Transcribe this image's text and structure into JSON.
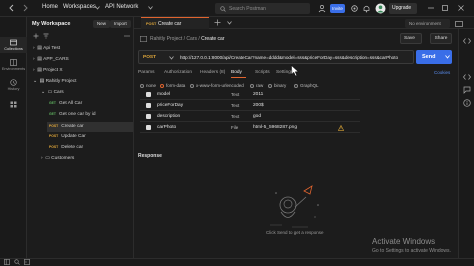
{
  "topbar": {
    "home": "Home",
    "workspaces": "Workspaces",
    "api_network": "API Network",
    "search_placeholder": "Search Postman",
    "invite": "Invite",
    "upgrade": "Upgrade"
  },
  "rail": {
    "collections": "Collections",
    "environments": "Environments",
    "history": "History"
  },
  "sidebar": {
    "workspace_title": "My Workspace",
    "new_label": "New",
    "import_label": "Import",
    "items": [
      {
        "label": "Api Test"
      },
      {
        "label": "APP_CARS"
      },
      {
        "label": "Project X"
      },
      {
        "label": "Rahitly Project"
      },
      {
        "label": "Cars"
      },
      {
        "method": "GET",
        "label": "Get All Car"
      },
      {
        "method": "GET",
        "label": "Get one car by id"
      },
      {
        "method": "POST",
        "label": "Create car"
      },
      {
        "method": "POST",
        "label": "Update Car"
      },
      {
        "method": "POST",
        "label": "Delete car"
      },
      {
        "label": "Customers"
      }
    ]
  },
  "tab": {
    "method": "POST",
    "title": "Create car"
  },
  "environment": "No environment",
  "request": {
    "breadcrumb_parent": "Rahitly Project / Cars /",
    "breadcrumb_current": "Create car",
    "save_label": "Save",
    "share_label": "Share",
    "method": "POST",
    "url": "http://127.0.0.1:8000/api/CreateCar?name=dddd&model=sss&priceForDay=sss&description=sss&carPhoto",
    "send_label": "Send",
    "tabs": [
      "Params",
      "Authorization",
      "Headers (8)",
      "Body",
      "Scripts",
      "Settings"
    ],
    "cookies_label": "Cookies",
    "body_modes": [
      "none",
      "form-data",
      "x-www-form-urlencoded",
      "raw",
      "binary",
      "GraphQL"
    ],
    "rows": [
      {
        "key": "model",
        "type": "Text",
        "value": "2011"
      },
      {
        "key": "priceForDay",
        "type": "Text",
        "value": "200$"
      },
      {
        "key": "description",
        "type": "Text",
        "value": "god"
      },
      {
        "key": "carPhoto",
        "type": "File",
        "value": "html-5_5968287.png"
      }
    ]
  },
  "response": {
    "label": "Response",
    "hint": "Click Send to get a response"
  },
  "watermark": {
    "line1": "Activate Windows",
    "line2": "Go to Settings to activate Windows."
  },
  "colors": {
    "accent": "#e0642e",
    "send": "#3a6ee8",
    "post": "#e0a73a",
    "get": "#5fb35f"
  }
}
